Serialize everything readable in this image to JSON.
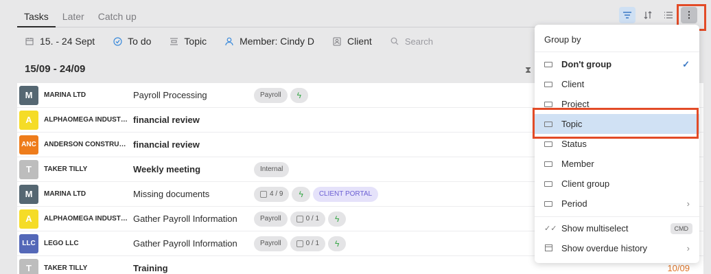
{
  "tabs": [
    "Tasks",
    "Later",
    "Catch up"
  ],
  "filters": {
    "date": "15. - 24 Sept",
    "status": "To do",
    "topic": "Topic",
    "member": "Member: Cindy D",
    "client": "Client",
    "search_placeholder": "Search"
  },
  "range_label": "15/09 - 24/09",
  "rows": [
    {
      "initials": "M",
      "color": "#556772",
      "client": "MARINA LTD",
      "task": "Payroll Processing",
      "bold": false
    },
    {
      "initials": "A",
      "color": "#f5dc27",
      "client": "ALPHAOMEGA INDUST…",
      "task": "financial review",
      "bold": true
    },
    {
      "initials": "ANC",
      "color": "#ee7c1b",
      "client": "ANDERSON CONSTRU…",
      "task": "financial review",
      "bold": true
    },
    {
      "initials": "T",
      "color": "#bdbdbd",
      "client": "TAKER TILLY",
      "task": "Weekly meeting",
      "bold": true
    },
    {
      "initials": "M",
      "color": "#556772",
      "client": "MARINA LTD",
      "task": "Missing documents",
      "bold": false
    },
    {
      "initials": "A",
      "color": "#f5dc27",
      "client": "ALPHAOMEGA INDUST…",
      "task": "Gather Payroll Information",
      "bold": false
    },
    {
      "initials": "LLC",
      "color": "#5468b8",
      "client": "LEGO LLC",
      "task": "Gather Payroll Information",
      "bold": false
    },
    {
      "initials": "T",
      "color": "#bdbdbd",
      "client": "TAKER TILLY",
      "task": "Training",
      "bold": true
    }
  ],
  "tags": {
    "payroll": "Payroll",
    "internal": "Internal",
    "progress_a": "4 / 9",
    "progress_b": "0 / 1",
    "portal": "CLIENT PORTAL",
    "bolt": "ϟ"
  },
  "last_row_date": "10/09",
  "menu": {
    "title": "Group by",
    "items": [
      {
        "label": "Don't group",
        "bold": true,
        "checked": true
      },
      {
        "label": "Client"
      },
      {
        "label": "Project"
      },
      {
        "label": "Topic",
        "selected": true
      },
      {
        "label": "Status"
      },
      {
        "label": "Member"
      },
      {
        "label": "Client group"
      },
      {
        "label": "Period",
        "submenu": true
      }
    ],
    "multiselect_label": "Show multiselect",
    "multiselect_kbd": "CMD",
    "overdue_label": "Show overdue history"
  },
  "colors": {
    "accent": "#3a78c4",
    "highlight_border": "#e24b27",
    "date_orange": "#e0772a"
  }
}
